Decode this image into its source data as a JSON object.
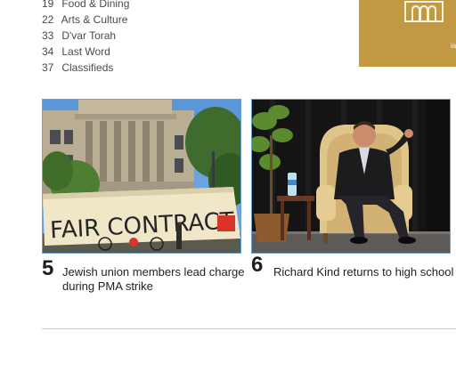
{
  "contents": [
    {
      "page": "19",
      "label": "Food & Dining"
    },
    {
      "page": "22",
      "label": "Arts & Culture"
    },
    {
      "page": "33",
      "label": "D'var Torah"
    },
    {
      "page": "34",
      "label": "Last Word"
    },
    {
      "page": "37",
      "label": "Classifieds"
    }
  ],
  "promo": {
    "color": "#c39a43",
    "icon": "building-icon",
    "text": "ia"
  },
  "stories": [
    {
      "number": "5",
      "headline": "Jewish union members lead charge during PMA strike",
      "banner_text": "FAIR CONTRACT NOW"
    },
    {
      "number": "6",
      "headline": "Richard Kind returns to high school"
    }
  ]
}
